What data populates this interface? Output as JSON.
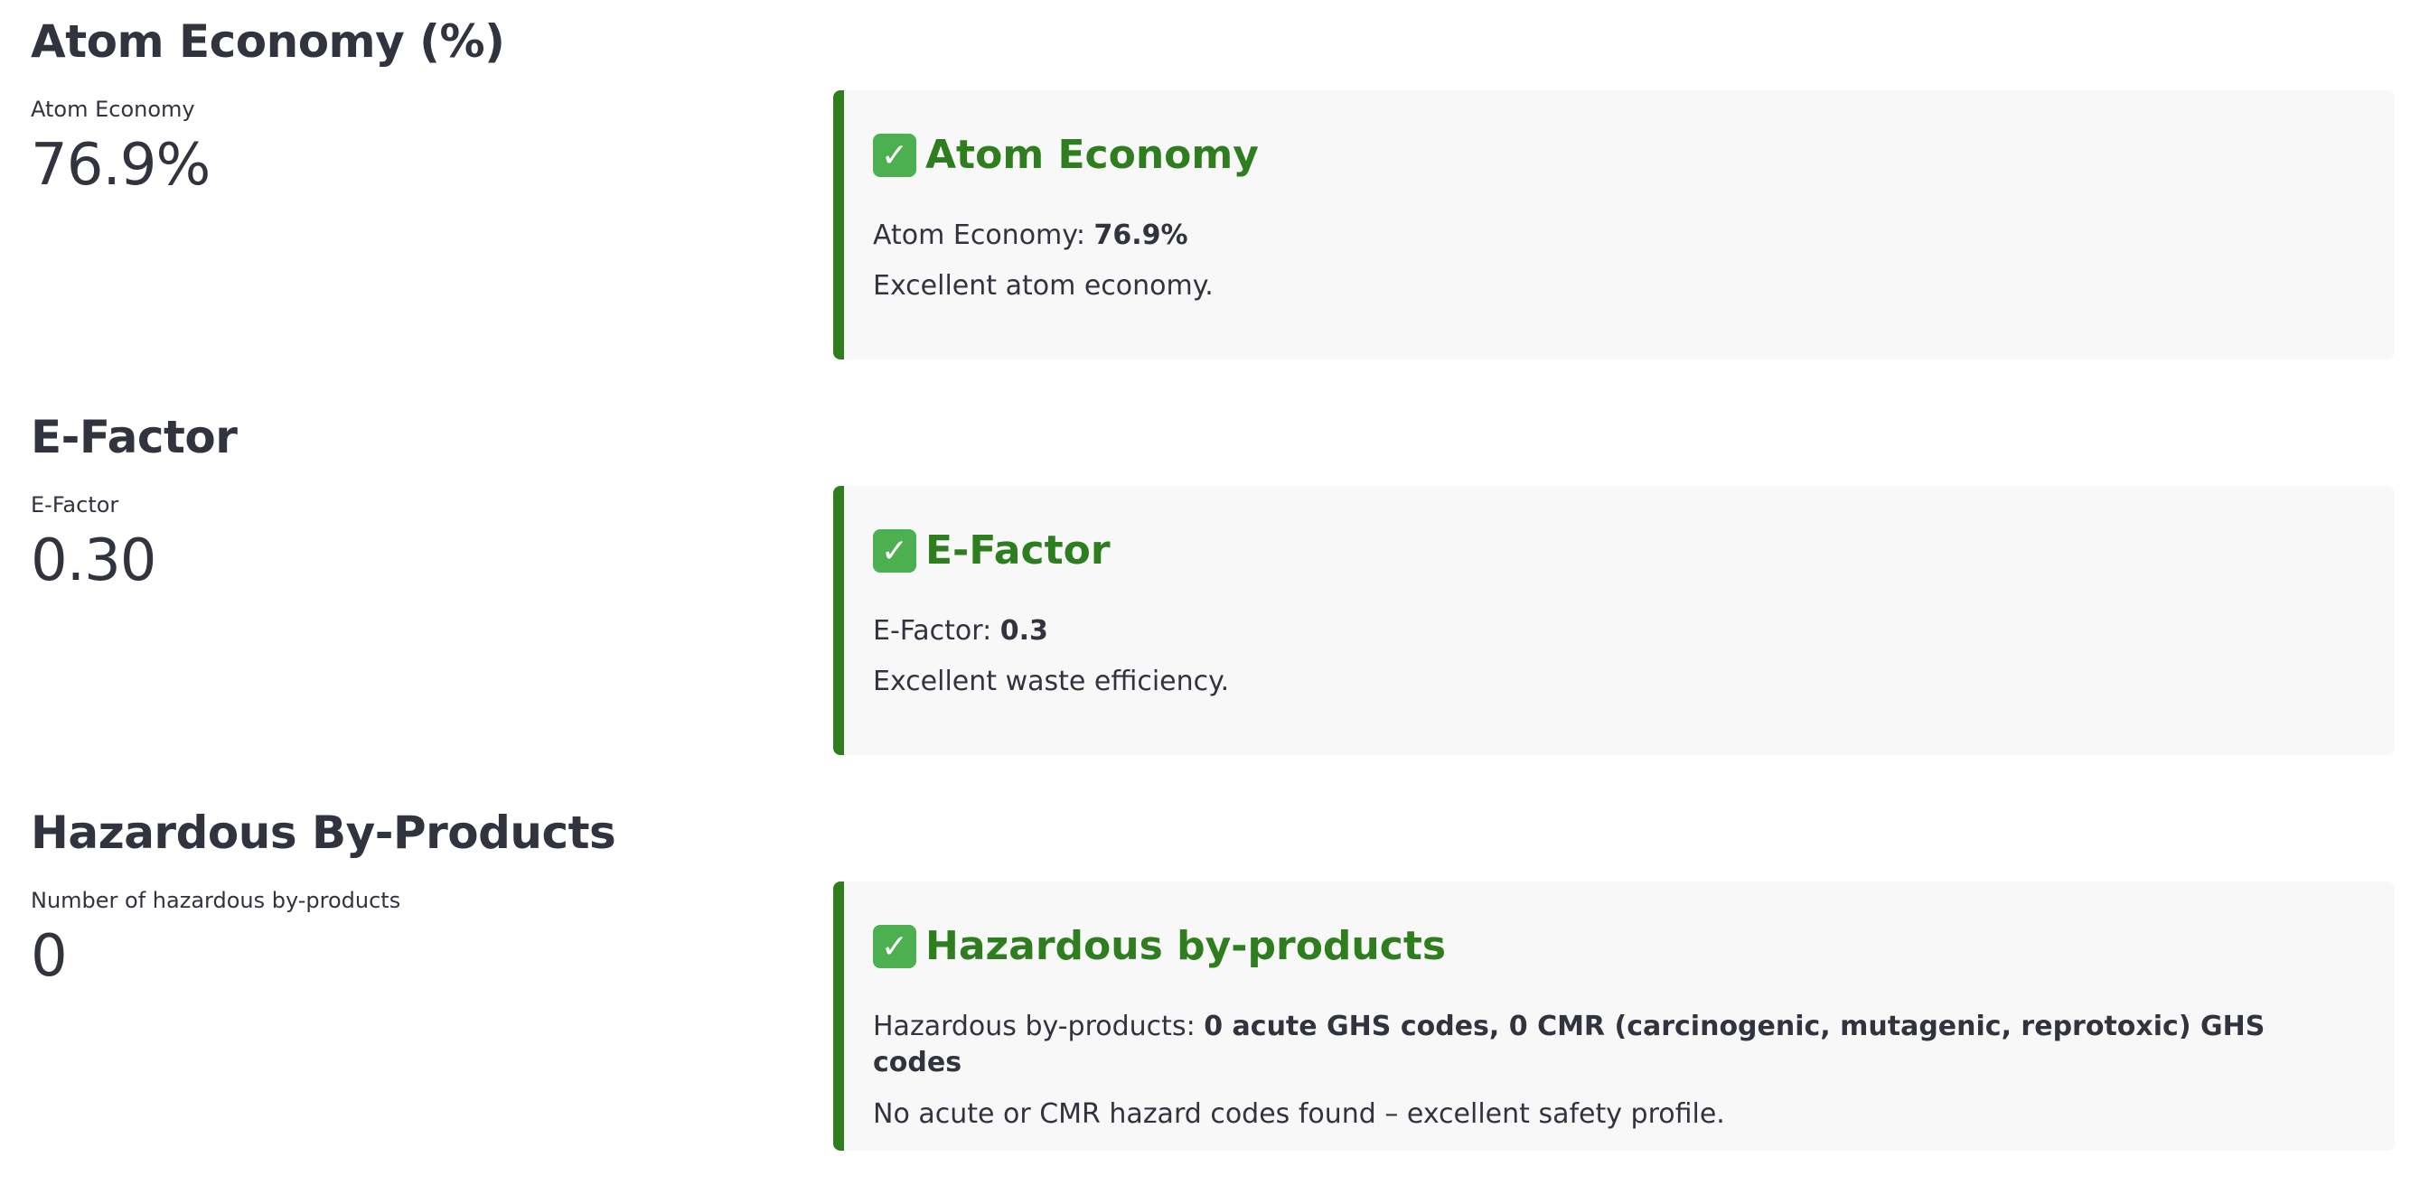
{
  "sections": [
    {
      "heading": "Atom Economy (%)",
      "metric_label": "Atom Economy",
      "metric_value": "76.9%",
      "card": {
        "title": "Atom Economy",
        "detail_prefix": "Atom Economy: ",
        "detail_value": "76.9%",
        "summary": "Excellent atom economy.",
        "status_icon": "check-icon"
      }
    },
    {
      "heading": "E-Factor",
      "metric_label": "E-Factor",
      "metric_value": "0.30",
      "card": {
        "title": "E-Factor",
        "detail_prefix": "E-Factor: ",
        "detail_value": "0.3",
        "summary": "Excellent waste efficiency.",
        "status_icon": "check-icon"
      }
    },
    {
      "heading": "Hazardous By-Products",
      "metric_label": "Number of hazardous by-products",
      "metric_value": "0",
      "card": {
        "title": "Hazardous by-products",
        "detail_prefix": "Hazardous by-products: ",
        "detail_value": "0 acute GHS codes, 0 CMR (carcinogenic, mutagenic, reprotoxic) GHS codes",
        "summary": "No acute or CMR hazard codes found – excellent safety profile.",
        "status_icon": "check-icon"
      }
    }
  ],
  "colors": {
    "success_text": "#2e7d1e",
    "success_border": "#2e7d1e",
    "check_icon_bg": "#4caf50",
    "card_bg": "#f8f8f8",
    "text": "#31333f"
  }
}
